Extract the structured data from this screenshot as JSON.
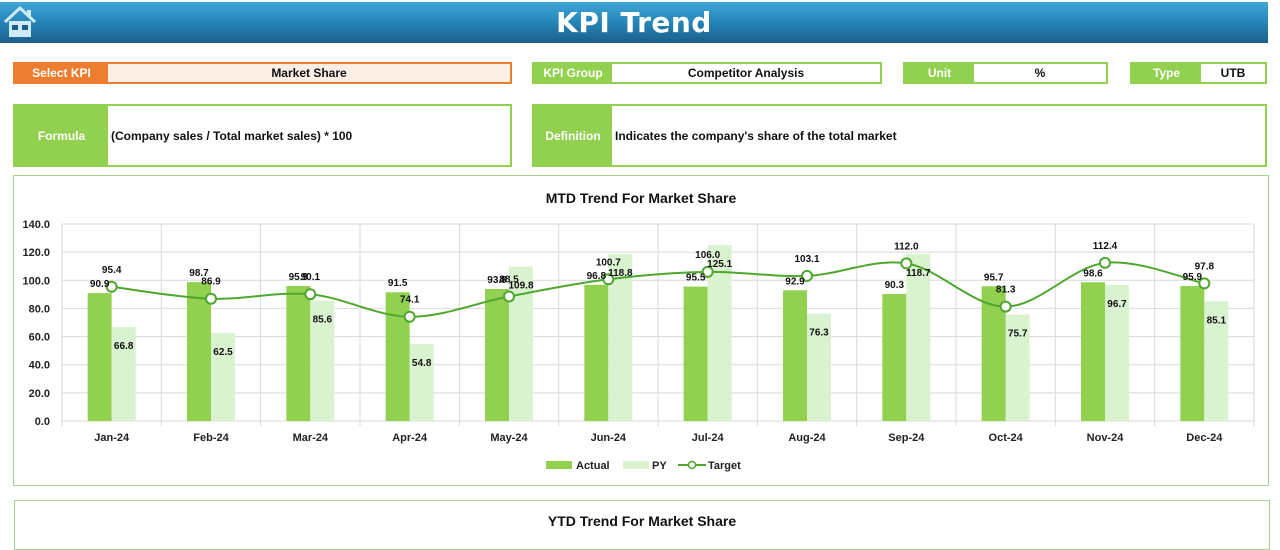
{
  "header": {
    "title": "KPI Trend",
    "home_icon": "home-icon"
  },
  "select_kpi": {
    "label": "Select KPI",
    "value": "Market Share"
  },
  "kpi_group": {
    "label": "KPI Group",
    "value": "Competitor Analysis"
  },
  "unit": {
    "label": "Unit",
    "value": "%"
  },
  "type": {
    "label": "Type",
    "value": "UTB"
  },
  "formula": {
    "label": "Formula",
    "value": "(Company sales / Total market sales) * 100"
  },
  "definition": {
    "label": "Definition",
    "value": "Indicates the company's share of the total market"
  },
  "colors": {
    "actual": "#92d050",
    "py": "#d9f2d0",
    "target": "#4ea72e",
    "accent_orange": "#ed7d31",
    "header_blue": "#2584b7"
  },
  "mtd_panel": {
    "title": "MTD Trend For Market Share"
  },
  "ytd_panel": {
    "title": "YTD Trend For Market Share"
  },
  "chart_data": {
    "type": "bar",
    "title": "MTD Trend For Market Share",
    "xlabel": "",
    "ylabel": "",
    "ylim": [
      0,
      140
    ],
    "yticks": [
      "0.0",
      "20.0",
      "40.0",
      "60.0",
      "80.0",
      "100.0",
      "120.0",
      "140.0"
    ],
    "grid": true,
    "legend": "bottom",
    "categories": [
      "Jan-24",
      "Feb-24",
      "Mar-24",
      "Apr-24",
      "May-24",
      "Jun-24",
      "Jul-24",
      "Aug-24",
      "Sep-24",
      "Oct-24",
      "Nov-24",
      "Dec-24"
    ],
    "series": [
      {
        "name": "Actual",
        "kind": "bar",
        "values": [
          90.9,
          98.7,
          95.9,
          91.5,
          93.8,
          96.8,
          95.5,
          92.9,
          90.3,
          95.7,
          98.6,
          95.9
        ]
      },
      {
        "name": "PY",
        "kind": "bar",
        "values": [
          66.8,
          62.5,
          85.6,
          54.8,
          109.8,
          118.8,
          125.1,
          76.3,
          118.7,
          75.7,
          96.7,
          85.1
        ]
      },
      {
        "name": "Target",
        "kind": "line",
        "values": [
          95.4,
          86.9,
          90.1,
          74.1,
          88.5,
          100.7,
          106.0,
          103.1,
          112.0,
          81.3,
          112.4,
          97.8
        ]
      }
    ]
  }
}
